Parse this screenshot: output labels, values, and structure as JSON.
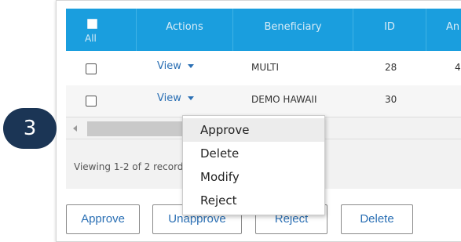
{
  "step_marker": "3",
  "table": {
    "headers": {
      "all_label": "All",
      "actions": "Actions",
      "beneficiary": "Beneficiary",
      "id": "ID",
      "amount": "An"
    },
    "rows": [
      {
        "action": "View",
        "beneficiary": "MULTI",
        "id": "28",
        "amount": "4"
      },
      {
        "action": "View",
        "beneficiary": "DEMO HAWAII",
        "id": "30",
        "amount": ""
      }
    ]
  },
  "pager": {
    "viewing_text": "Viewing 1-2 of 2 records"
  },
  "action_menu": {
    "items": [
      "Approve",
      "Delete",
      "Modify",
      "Reject"
    ],
    "highlighted_index": 0
  },
  "buttons": {
    "approve": "Approve",
    "unapprove": "Unapprove",
    "reject": "Reject",
    "delete": "Delete"
  },
  "colors": {
    "header_bg": "#1a9ede",
    "link": "#2a6fb4",
    "step_marker_bg": "#1b3555"
  }
}
